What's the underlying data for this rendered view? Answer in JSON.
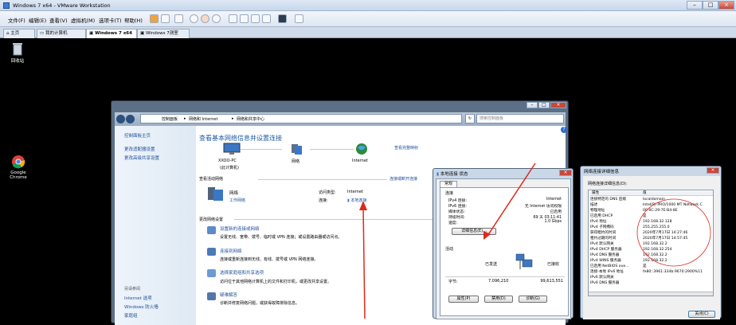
{
  "vm": {
    "title": "Windows 7 x64 - VMware Workstation",
    "menu": [
      "文件(F)",
      "编辑(E)",
      "查看(V)",
      "虚拟机(M)",
      "选项卡(T)",
      "帮助(H)"
    ],
    "tabs": [
      "主页",
      "我的计算机",
      "Windows 7 x64",
      "Windows 7测室"
    ]
  },
  "desktop": {
    "recycle": "回收站",
    "chrome": "Google\nChrome"
  },
  "cp": {
    "breadcrumb": [
      "控制面板",
      "网络和 Internet",
      "网络和共享中心"
    ],
    "search_placeholder": "搜索控制面板",
    "left": {
      "home": "控制面板主页",
      "items": [
        "更改适配器设置",
        "更改高级共享设置"
      ],
      "see_also": "另请参阅",
      "bottom": [
        "Internet 选项",
        "Windows 防火墙",
        "家庭组"
      ]
    },
    "heading": "查看基本网络信息并设置连接",
    "full_map": "查看完整映射",
    "pc_name": "XXOO-PC",
    "pc_sub": "(此计算机)",
    "net_label": "网络",
    "internet_label": "Internet",
    "active_nets": "查看活动网络",
    "connect_link": "连接或断开连接",
    "net_name": "网络",
    "net_type": "工作网络",
    "access_type_label": "访问类型:",
    "access_type": "Internet",
    "conn_label": "连接:",
    "conn_value": "本地连接",
    "change_heading": "更改网络设置",
    "tasks": [
      {
        "title": "设置新的连接或网络",
        "desc": "设置无线、宽带、拨号、临时或 VPN 连接；或设置路由器或访问点。"
      },
      {
        "title": "连接到网络",
        "desc": "连接或重新连接到无线、有线、拨号或 VPN 网络连接。"
      },
      {
        "title": "选择家庭组和共享选项",
        "desc": "访问位于其他网络计算机上的文件和打印机，或更改共享设置。"
      },
      {
        "title": "疑难解答",
        "desc": "诊断并修复网络问题，或获得故障排除信息。"
      }
    ]
  },
  "status": {
    "title": "本地连接 状态",
    "tab": "常规",
    "conn_heading": "连接",
    "rows": [
      {
        "k": "IPv4 连接:",
        "v": "Internet"
      },
      {
        "k": "IPv6 连接:",
        "v": "无 Internet 访问权限"
      },
      {
        "k": "媒体状态:",
        "v": "已启用"
      },
      {
        "k": "持续时间:",
        "v": "69 天 03:11:41"
      },
      {
        "k": "速度:",
        "v": "1.0 Gbps"
      }
    ],
    "details_btn": "详细信息(E)...",
    "activity": "活动",
    "sent": "已发送",
    "received": "已接收",
    "bytes_label": "字节:",
    "sent_bytes": "7,096,210",
    "recv_bytes": "99,613,551",
    "btns": [
      "属性(P)",
      "禁用(D)",
      "诊断(G)"
    ]
  },
  "details": {
    "title": "网络连接详细信息",
    "subtitle": "网络连接详细信息(D):",
    "col1": "属性",
    "col2": "值",
    "rows": [
      {
        "k": "连接特定的 DNS 后缀",
        "v": "localdomain"
      },
      {
        "k": "描述",
        "v": "Intel(R) PRO/1000 MT Network C"
      },
      {
        "k": "物理地址",
        "v": "00-0C-29-7E-B4-8E"
      },
      {
        "k": "已启用 DHCP",
        "v": "是"
      },
      {
        "k": "IPv4 地址",
        "v": "192.168.32.128"
      },
      {
        "k": "IPv4 子网掩码",
        "v": "255.255.255.0"
      },
      {
        "k": "获得租约的时间",
        "v": "2020年7月17日 14:27:46"
      },
      {
        "k": "租约过期的时间",
        "v": "2020年7月17日 14:57:45"
      },
      {
        "k": "IPv4 默认网关",
        "v": "192.168.32.2"
      },
      {
        "k": "IPv4 DHCP 服务器",
        "v": "192.168.32.254"
      },
      {
        "k": "IPv4 DNS 服务器",
        "v": "192.168.32.2"
      },
      {
        "k": "IPv4 WINS 服务器",
        "v": "192.168.32.2"
      },
      {
        "k": "已启用 NetBIOS ove...",
        "v": "是"
      },
      {
        "k": "连接-本地 IPv6 地址",
        "v": "fe80::3961:334b:9670:2900%11"
      },
      {
        "k": "IPv6 默认网关",
        "v": ""
      },
      {
        "k": "IPv6 DNS 服务器",
        "v": ""
      }
    ],
    "close": "关闭(C)"
  }
}
